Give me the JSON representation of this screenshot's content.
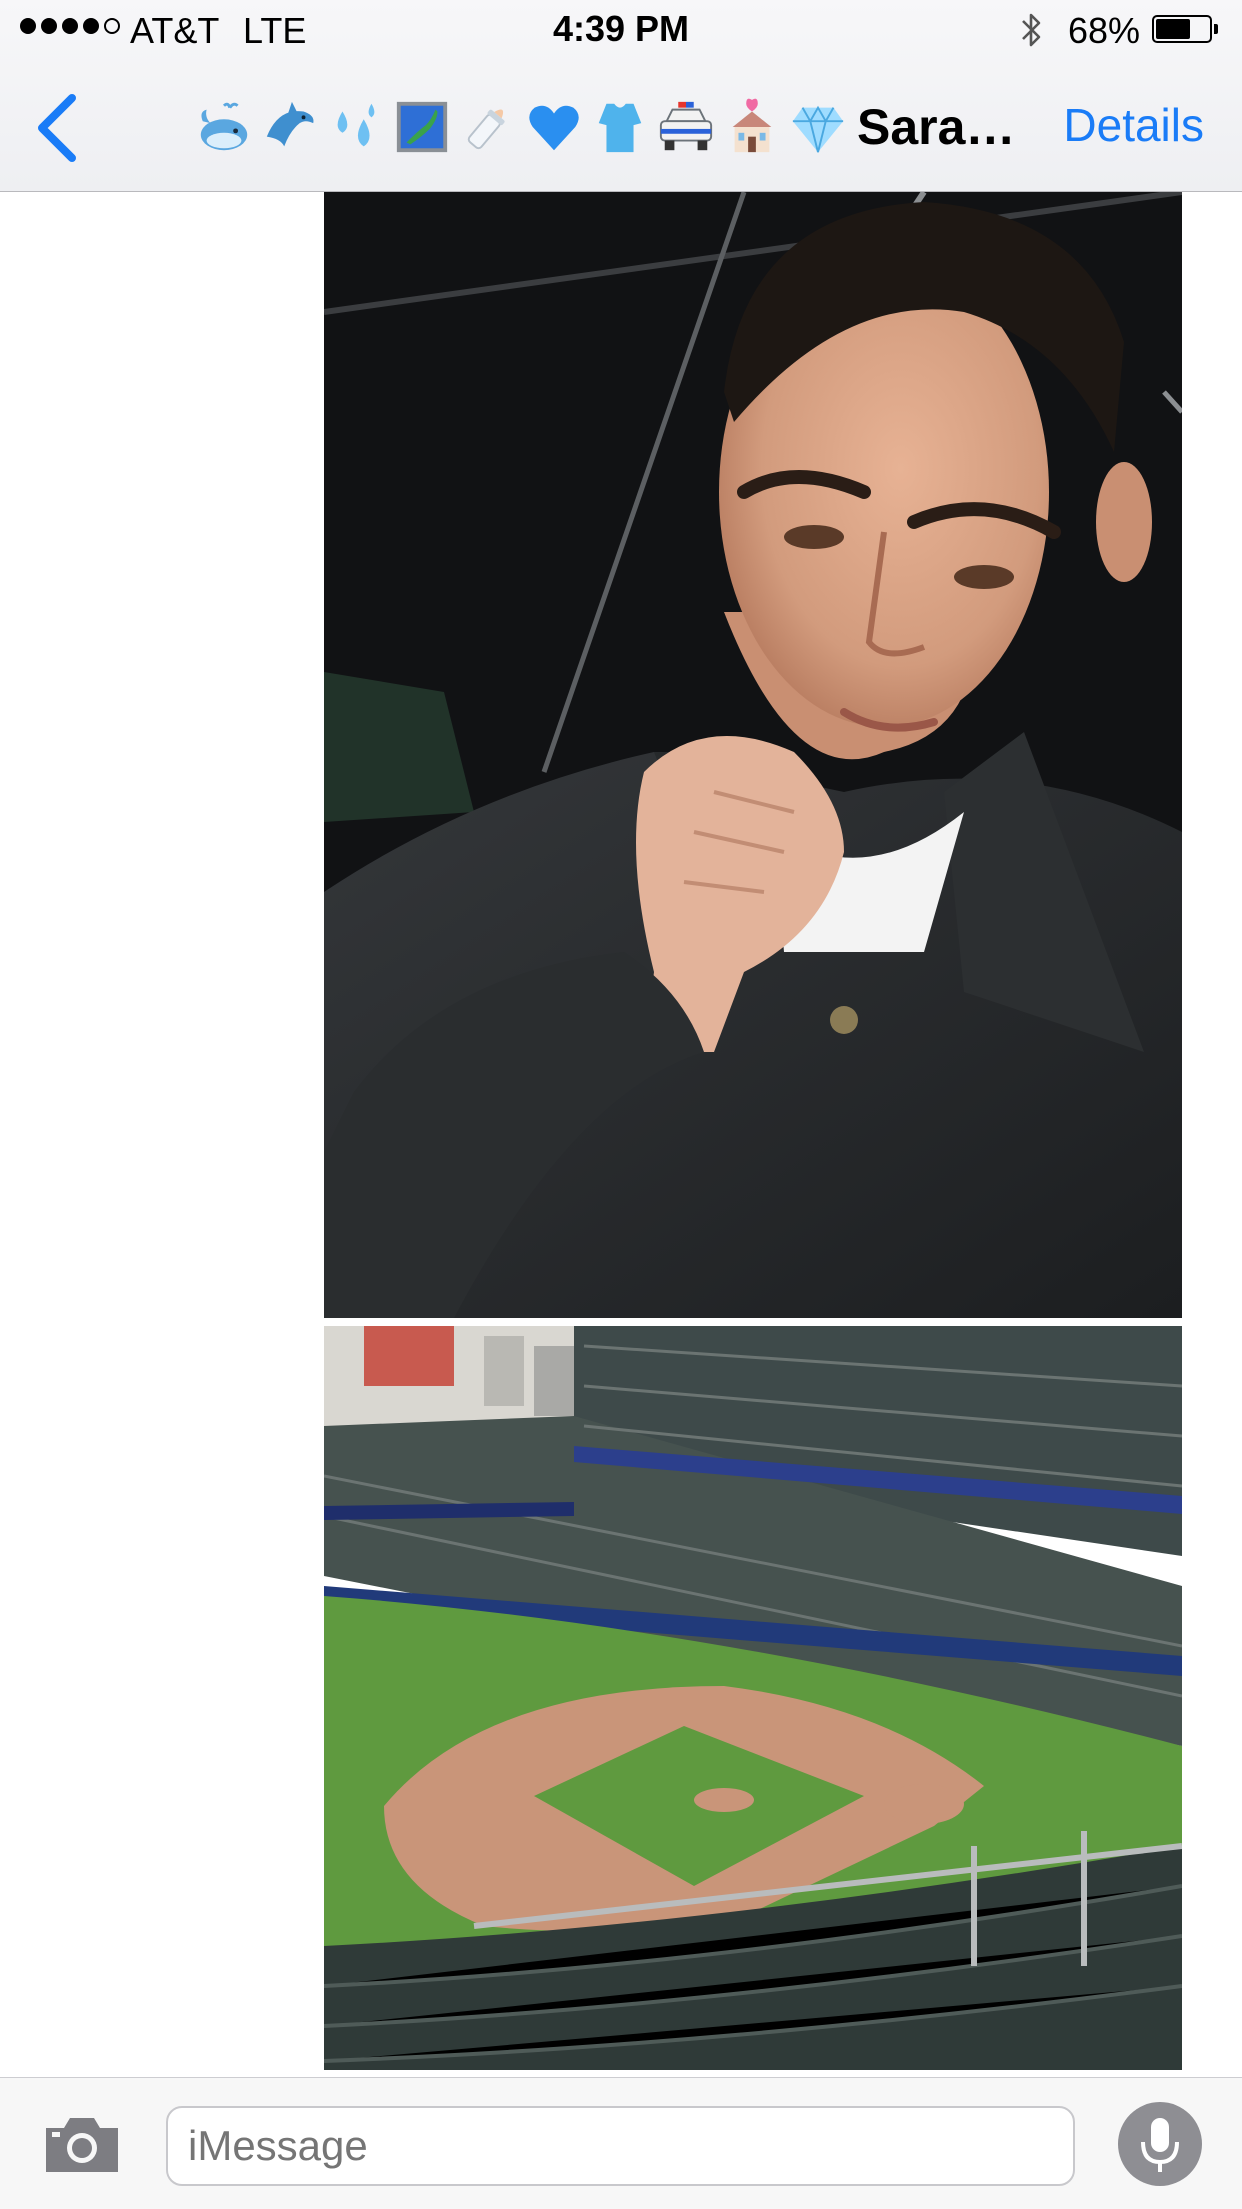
{
  "status_bar": {
    "carrier": "AT&T",
    "network": "LTE",
    "time": "4:39 PM",
    "battery_percent": "68%",
    "battery_level": 0.68,
    "signal_bars": 4,
    "signal_max": 5,
    "bluetooth_icon": "bluetooth-icon"
  },
  "header": {
    "back_icon": "chevron-left-icon",
    "emojis": [
      "whale",
      "dolphin",
      "sweat-droplets",
      "map-of-japan",
      "baby-bottle",
      "blue-heart",
      "blue-shirt",
      "police-car",
      "wedding-chapel",
      "gem"
    ],
    "contact_name": "Sara…",
    "details_label": "Details",
    "accent_color": "#1a7cf7"
  },
  "messages": [
    {
      "type": "photo",
      "subject": "selfie"
    },
    {
      "type": "photo",
      "subject": "ballpark"
    }
  ],
  "composer": {
    "camera_icon": "camera-icon",
    "placeholder": "iMessage",
    "mic_icon": "microphone-icon"
  }
}
